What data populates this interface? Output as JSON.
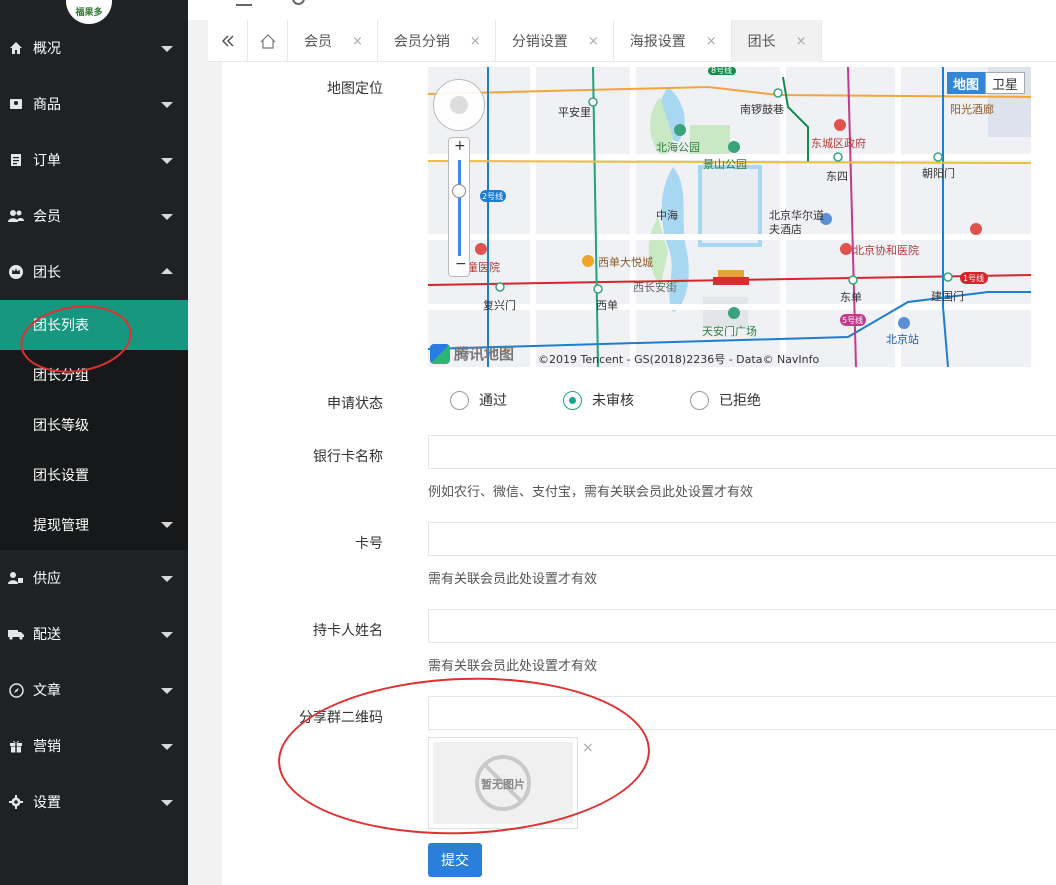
{
  "app": {
    "logo_text": "福果多"
  },
  "sidebar": {
    "items": [
      {
        "label": "概况",
        "icon": "home-icon"
      },
      {
        "label": "商品",
        "icon": "goods-icon"
      },
      {
        "label": "订单",
        "icon": "order-icon"
      },
      {
        "label": "会员",
        "icon": "users-icon"
      },
      {
        "label": "团长",
        "icon": "crown-icon"
      },
      {
        "label": "供应",
        "icon": "supply-icon"
      },
      {
        "label": "配送",
        "icon": "truck-icon"
      },
      {
        "label": "文章",
        "icon": "compass-icon"
      },
      {
        "label": "营销",
        "icon": "gift-icon"
      },
      {
        "label": "设置",
        "icon": "gear-icon"
      }
    ],
    "submenu": [
      {
        "label": "团长列表"
      },
      {
        "label": "团长分组"
      },
      {
        "label": "团长等级"
      },
      {
        "label": "团长设置"
      },
      {
        "label": "提现管理"
      }
    ]
  },
  "tabs": {
    "items": [
      {
        "label": "会员"
      },
      {
        "label": "会员分销"
      },
      {
        "label": "分销设置"
      },
      {
        "label": "海报设置"
      },
      {
        "label": "团长"
      }
    ],
    "close_glyph": "×"
  },
  "form": {
    "map_label": "地图定位",
    "status_label": "申请状态",
    "status_options": [
      "通过",
      "未审核",
      "已拒绝"
    ],
    "status_selected": "未审核",
    "bank_label": "银行卡名称",
    "bank_hint": "例如农行、微信、支付宝，需有关联会员此处设置才有效",
    "card_label": "卡号",
    "card_hint": "需有关联会员此处设置才有效",
    "holder_label": "持卡人姓名",
    "holder_hint": "需有关联会员此处设置才有效",
    "qrcode_label": "分享群二维码",
    "no_image_text": "暂无图片",
    "submit_label": "提交"
  },
  "map": {
    "btn_map": "地图",
    "btn_satellite": "卫星",
    "brand": "腾讯地图",
    "copyright": "©2019 Tencent - GS(2018)2236号 - Data© NavInfo",
    "places": [
      "平安里",
      "南锣鼓巷",
      "阳光酒廊",
      "北海公园",
      "景山公园",
      "东城区政府",
      "东四",
      "朝阳门",
      "中海",
      "北京华尔道夫酒店",
      "北京协和医院",
      "西单大悦城",
      "儿童医院",
      "复兴门",
      "西单",
      "西长安街",
      "天安门广场",
      "东单",
      "建国门",
      "北京站"
    ],
    "line_labels": [
      "2号线",
      "1号线",
      "5号线",
      "8号线"
    ]
  },
  "colors": {
    "accent": "#17977f",
    "primary": "#2b7fd8",
    "sidebar": "#1f2224"
  }
}
